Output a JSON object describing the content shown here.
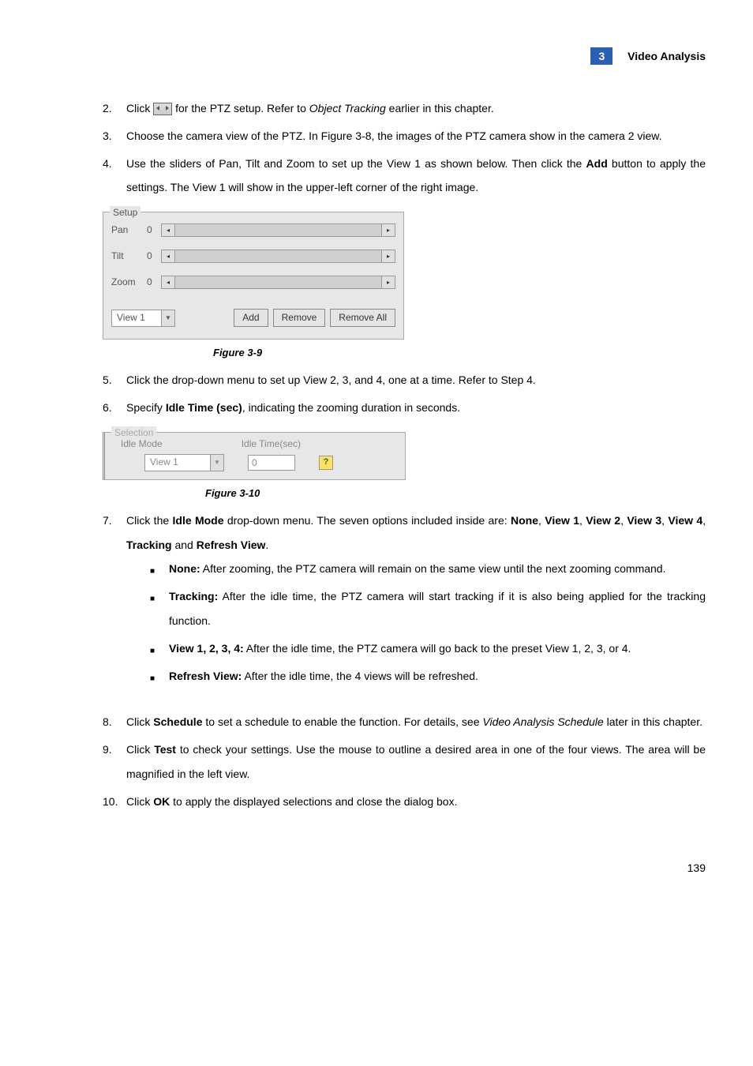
{
  "header": {
    "chapter_num": "3",
    "chapter_title": "Video Analysis"
  },
  "items": {
    "n2": {
      "num": "2.",
      "pre": "Click ",
      "post": " for the PTZ setup. Refer to ",
      "em": "Object Tracking",
      "tail": " earlier in this chapter."
    },
    "n3": {
      "num": "3.",
      "text": "Choose the camera view of the PTZ. In Figure 3-8, the images of the PTZ camera show in the camera 2 view."
    },
    "n4": {
      "num": "4.",
      "pre": "Use the sliders of Pan, Tilt and Zoom to set up the View 1 as shown below. Then click the ",
      "b": "Add",
      "post": " button to apply the settings. The View 1 will show in the upper-left corner of the right image."
    },
    "n5": {
      "num": "5.",
      "text": "Click the drop-down menu to set up View 2, 3, and 4, one at a time. Refer to Step 4."
    },
    "n6": {
      "num": "6.",
      "pre": "Specify ",
      "b": "Idle Time (sec)",
      "post": ", indicating the zooming duration in seconds."
    },
    "n7": {
      "num": "7.",
      "pre": "Click the ",
      "b1": "Idle Mode",
      "mid": " drop-down menu. The seven options included inside are: ",
      "opts": [
        "None",
        "View 1",
        "View 2",
        "View 3",
        "View 4",
        "Tracking",
        "Refresh View"
      ]
    },
    "sub": {
      "none": {
        "b": "None:",
        "t": " After zooming, the PTZ camera will remain on the same view until the next zooming command."
      },
      "tracking": {
        "b": "Tracking:",
        "t": " After the idle time, the PTZ camera will start tracking if it is also being applied for the tracking function."
      },
      "view": {
        "b": "View 1, 2, 3, 4:",
        "t": " After the idle time, the PTZ camera will go back to the preset View 1, 2, 3, or 4."
      },
      "refresh": {
        "b": "Refresh View:",
        "t": " After the idle time, the 4 views will be refreshed."
      }
    },
    "n8": {
      "num": "8.",
      "pre": "Click ",
      "b": "Schedule",
      "mid": " to set a schedule to enable the function. For details, see ",
      "em": "Video Analysis Schedule",
      "post": " later in this chapter."
    },
    "n9": {
      "num": "9.",
      "pre": "Click ",
      "b": "Test",
      "post": " to check your settings. Use the mouse to outline a desired area in one of the four views. The area will be magnified in the left view."
    },
    "n10": {
      "num": "10.",
      "pre": "Click ",
      "b": "OK",
      "post": " to apply the displayed selections and close the dialog box."
    }
  },
  "fig_setup": {
    "title": "Setup",
    "pan": {
      "label": "Pan",
      "val": "0"
    },
    "tilt": {
      "label": "Tilt",
      "val": "0"
    },
    "zoom": {
      "label": "Zoom",
      "val": "0"
    },
    "combo": "View 1",
    "btn_add": "Add",
    "btn_remove": "Remove",
    "btn_removeall": "Remove All",
    "caption": "Figure 3-9"
  },
  "fig_selection": {
    "title": "Selection",
    "idle_mode_label": "Idle Mode",
    "idle_time_label": "Idle Time(sec)",
    "combo": "View 1",
    "value": "0",
    "caption": "Figure 3-10"
  },
  "joiners": {
    "comma_sp": ", ",
    "and_sp": " and ",
    "period": "."
  },
  "page_num": "139"
}
